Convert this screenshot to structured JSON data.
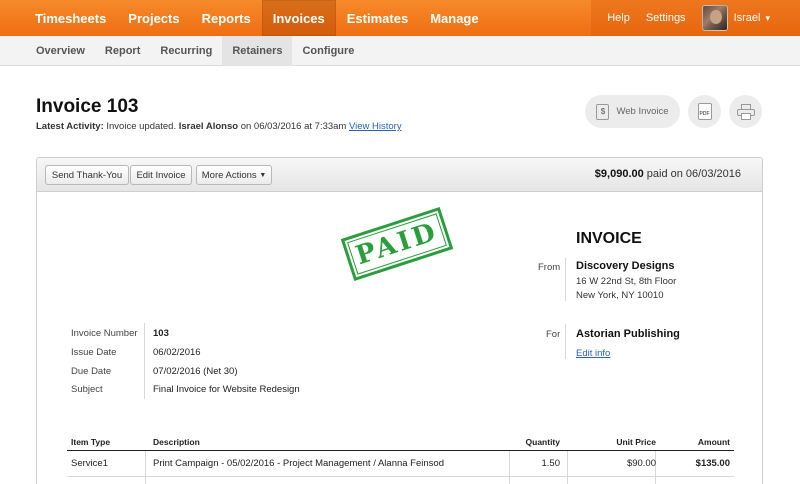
{
  "topnav": {
    "items": [
      {
        "label": "Timesheets"
      },
      {
        "label": "Projects"
      },
      {
        "label": "Reports"
      },
      {
        "label": "Invoices",
        "active": true
      },
      {
        "label": "Estimates"
      },
      {
        "label": "Manage"
      }
    ],
    "help": "Help",
    "settings": "Settings",
    "user_name": "Israel",
    "chevron": "▾",
    "accent": "#f07a1c"
  },
  "subnav": {
    "items": [
      {
        "label": "Overview"
      },
      {
        "label": "Report"
      },
      {
        "label": "Recurring"
      },
      {
        "label": "Retainers",
        "active": true
      },
      {
        "label": "Configure"
      }
    ]
  },
  "header": {
    "title": "Invoice 103",
    "activity_label": "Latest Activity:",
    "activity_text": " Invoice updated. ",
    "activity_user": "Israel Alonso",
    "activity_time": " on 06/03/2016 at 7:33am ",
    "view_history": "View History"
  },
  "tools": {
    "web_invoice": "Web Invoice",
    "web_icon_glyph": "$",
    "pdf_glyph": "PDF",
    "icons": [
      "web-invoice-icon",
      "pdf-icon",
      "printer-icon"
    ]
  },
  "actions": {
    "send_thank_you": "Send Thank-You",
    "edit_invoice": "Edit Invoice",
    "more_actions": "More Actions",
    "more_caret": "▼",
    "paid_amount": "$9,090.00",
    "paid_text": " paid on 06/03/2016"
  },
  "invoice": {
    "stamp": "PAID",
    "stamp_color": "#2a9e3c",
    "heading": "INVOICE",
    "from_label": "From",
    "from_name": "Discovery Designs",
    "from_address_1": "16 W 22nd St, 8th Floor",
    "from_address_2": "New York, NY 10010",
    "for_label": "For",
    "for_name": "Astorian Publishing",
    "edit_info": "Edit info",
    "meta": [
      {
        "label": "Invoice Number",
        "value": "103"
      },
      {
        "label": "Issue Date",
        "value": "06/02/2016"
      },
      {
        "label": "Due Date",
        "value": "07/02/2016 (Net 30)"
      },
      {
        "label": "Subject",
        "value": "Final Invoice for Website Redesign"
      }
    ]
  },
  "items": {
    "columns": [
      "Item Type",
      "Description",
      "Quantity",
      "Unit Price",
      "Amount"
    ],
    "rows": [
      {
        "type": "Service1",
        "description": "Print Campaign - 05/02/2016 - Project Management / Alanna Feinsod",
        "quantity": "1.50",
        "unit_price": "$90.00",
        "amount": "$135.00"
      }
    ]
  }
}
